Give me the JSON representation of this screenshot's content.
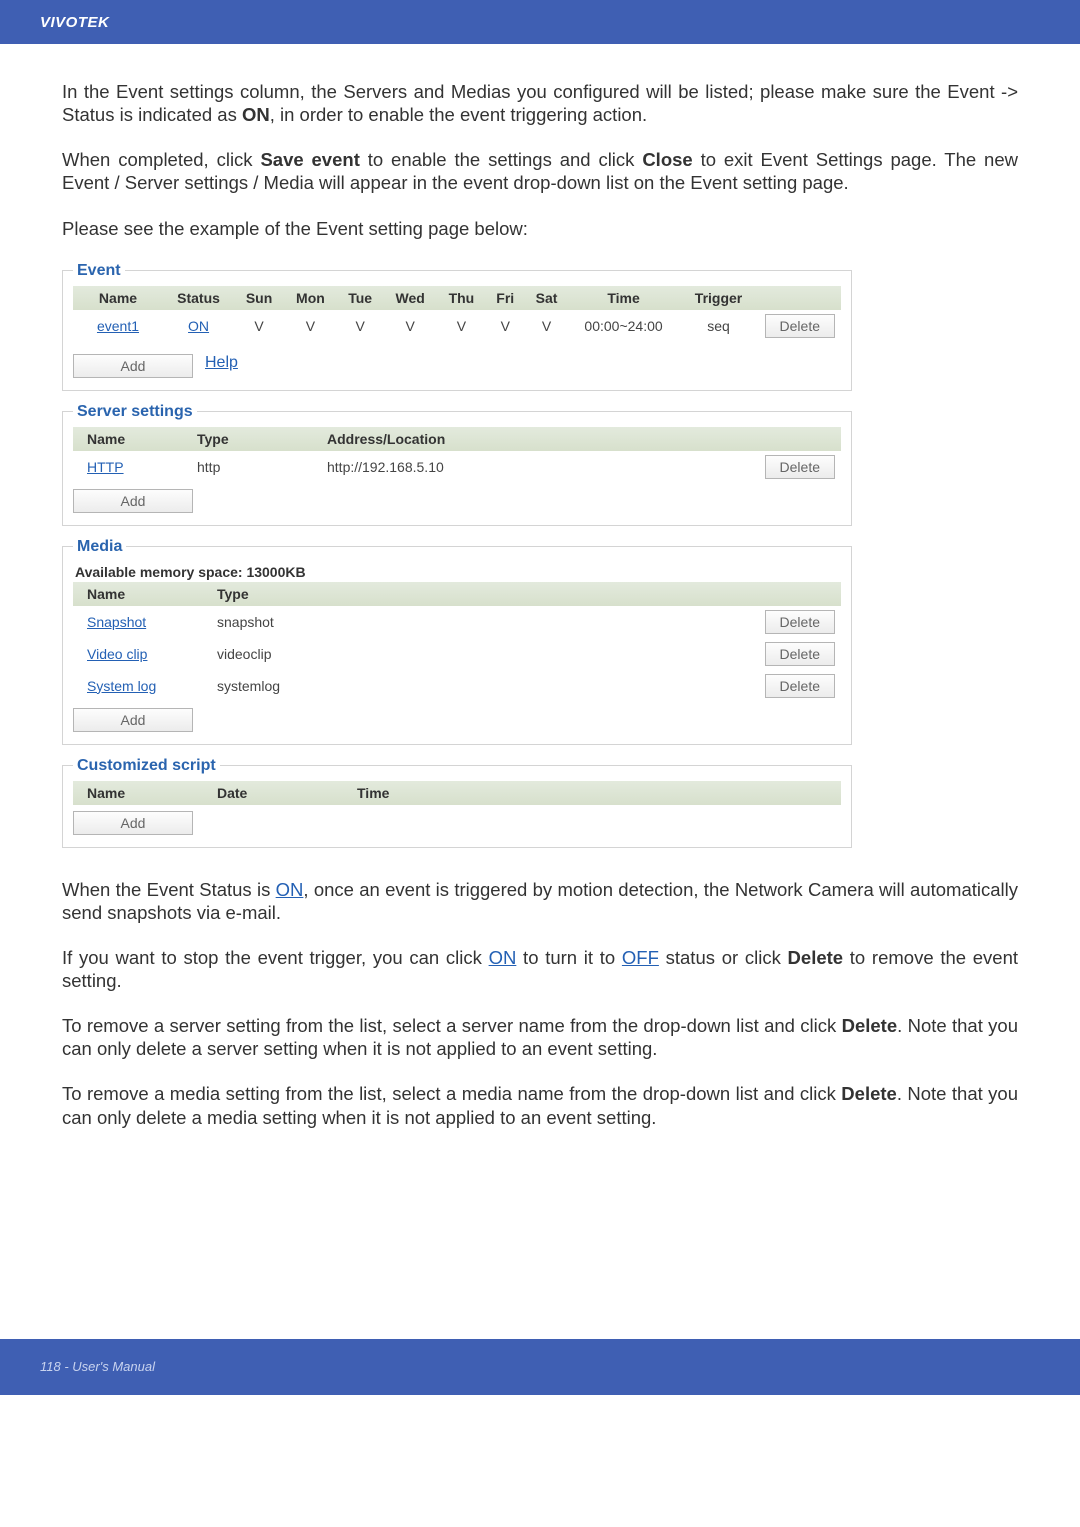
{
  "brand": "VIVOTEK",
  "para1": "In the Event settings column, the Servers and Medias you configured will be listed; please make sure the Event -> Status is indicated as ",
  "para1_on": "ON",
  "para1_tail": ", in order to enable the event triggering action.",
  "para2a": "When completed, click ",
  "para2_save": "Save event",
  "para2b": " to enable the settings and click ",
  "para2_close": "Close",
  "para2c": " to exit Event Settings page. The new Event / Server settings / Media will appear in the event drop-down list on the Event setting page.",
  "para3": "Please see the example of the Event setting page below:",
  "event": {
    "legend": "Event",
    "headers": [
      "Name",
      "Status",
      "Sun",
      "Mon",
      "Tue",
      "Wed",
      "Thu",
      "Fri",
      "Sat",
      "Time",
      "Trigger",
      ""
    ],
    "row": {
      "name": "event1",
      "status": "ON",
      "sun": "V",
      "mon": "V",
      "tue": "V",
      "wed": "V",
      "thu": "V",
      "fri": "V",
      "sat": "V",
      "time": "00:00~24:00",
      "trigger": "seq",
      "delete": "Delete"
    },
    "add": "Add",
    "help": "Help"
  },
  "server": {
    "legend": "Server settings",
    "name_hdr": "Name",
    "type_hdr": "Type",
    "addr_hdr": "Address/Location",
    "name": "HTTP",
    "type": "http",
    "addr": "http://192.168.5.10",
    "delete": "Delete",
    "add": "Add"
  },
  "media": {
    "legend": "Media",
    "avail": "Available memory space: 13000KB",
    "name_hdr": "Name",
    "type_hdr": "Type",
    "rows": [
      {
        "name": "Snapshot",
        "type": "snapshot",
        "delete": "Delete"
      },
      {
        "name": "Video clip",
        "type": "videoclip",
        "delete": "Delete"
      },
      {
        "name": "System log",
        "type": "systemlog",
        "delete": "Delete"
      }
    ],
    "add": "Add"
  },
  "cs": {
    "legend": "Customized script",
    "name_hdr": "Name",
    "date_hdr": "Date",
    "time_hdr": "Time",
    "add": "Add"
  },
  "para4a": "When the Event Status is ",
  "para4_on": "ON",
  "para4b": ", once an event is triggered by motion detection, the Network Camera will automatically send snapshots via e-mail.",
  "para5a": "If you want to stop the event trigger, you can click ",
  "para5_on": "ON",
  "para5b": " to turn it to ",
  "para5_off": "OFF",
  "para5c": " status or click ",
  "para5_del": "Delete",
  "para5d": " to remove the event setting.",
  "para6a": "To remove a server setting from the list, select a server name from the drop-down list and click ",
  "para6_del": "Delete",
  "para6b": ". Note that you can only delete a server setting when it is not applied to an event setting.",
  "para7a": "To remove a media setting from the list, select a media name from the drop-down list and click ",
  "para7_del": "Delete",
  "para7b": ". Note that you can only delete a media setting when it is not applied to an event setting.",
  "footer": "118 - User's Manual"
}
